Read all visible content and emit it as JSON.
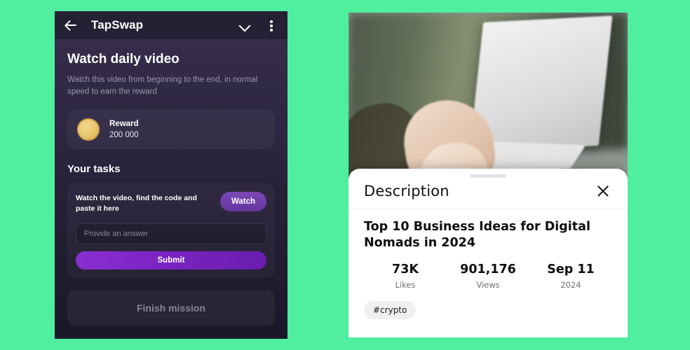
{
  "background_color": "#4fef9f",
  "left_phone": {
    "app_bar": {
      "back_icon": "arrow-left-icon",
      "title": "TapSwap",
      "chevron_icon": "chevron-down-icon",
      "menu_icon": "kebab-menu-icon"
    },
    "page_heading": "Watch daily video",
    "page_subtitle": "Watch this video from beginning to the end, in normal speed to earn the reward",
    "reward_card": {
      "coin_icon": "gold-coin-icon",
      "label": "Reward",
      "value": "200 000",
      "coin_color": "#e7c46a"
    },
    "section_title": "Your tasks",
    "task": {
      "description": "Watch the video, find the code and paste it here",
      "watch_label": "Watch",
      "watch_color": "#6b3fa8",
      "input_placeholder": "Provide an answer",
      "input_value": "",
      "submit_label": "Submit",
      "submit_color": "#7a24c2"
    },
    "finish_label": "Finish mission"
  },
  "right_phone": {
    "video_thumbnail_alt": "person typing on a laptop at a wooden table with a coffee mug",
    "sheet": {
      "drag_handle": "drag-handle",
      "title": "Description",
      "close_icon": "close-x-icon",
      "video_title": "Top 10 Business Ideas for Digital Nomads in 2024",
      "stats": [
        {
          "value": "73K",
          "label": "Likes"
        },
        {
          "value": "901,176",
          "label": "Views"
        },
        {
          "value": "Sep 11",
          "label": "2024"
        }
      ],
      "tags": [
        "#crypto"
      ]
    }
  }
}
